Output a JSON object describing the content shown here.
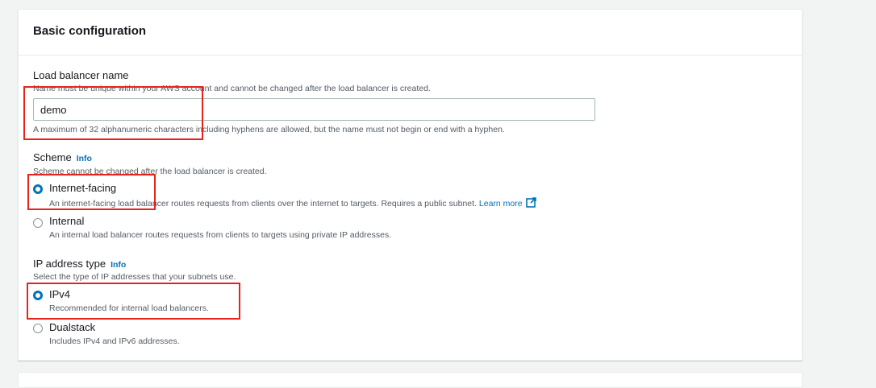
{
  "section": {
    "title": "Basic configuration"
  },
  "load_balancer_name": {
    "label": "Load balancer name",
    "description": "Name must be unique within your AWS account and cannot be changed after the load balancer is created.",
    "value": "demo",
    "constraint": "A maximum of 32 alphanumeric characters including hyphens are allowed, but the name must not begin or end with a hyphen."
  },
  "scheme": {
    "label": "Scheme",
    "info": "Info",
    "description": "Scheme cannot be changed after the load balancer is created.",
    "options": [
      {
        "label": "Internet-facing",
        "description": "An internet-facing load balancer routes requests from clients over the internet to targets. Requires a public subnet.",
        "link": "Learn more",
        "selected": true
      },
      {
        "label": "Internal",
        "description": "An internal load balancer routes requests from clients to targets using private IP addresses.",
        "selected": false
      }
    ]
  },
  "ip_address_type": {
    "label": "IP address type",
    "info": "Info",
    "description": "Select the type of IP addresses that your subnets use.",
    "options": [
      {
        "label": "IPv4",
        "description": "Recommended for internal load balancers.",
        "selected": true
      },
      {
        "label": "Dualstack",
        "description": "Includes IPv4 and IPv6 addresses.",
        "selected": false
      }
    ]
  },
  "colors": {
    "accent": "#0073bb",
    "highlight": "#e8231c"
  }
}
